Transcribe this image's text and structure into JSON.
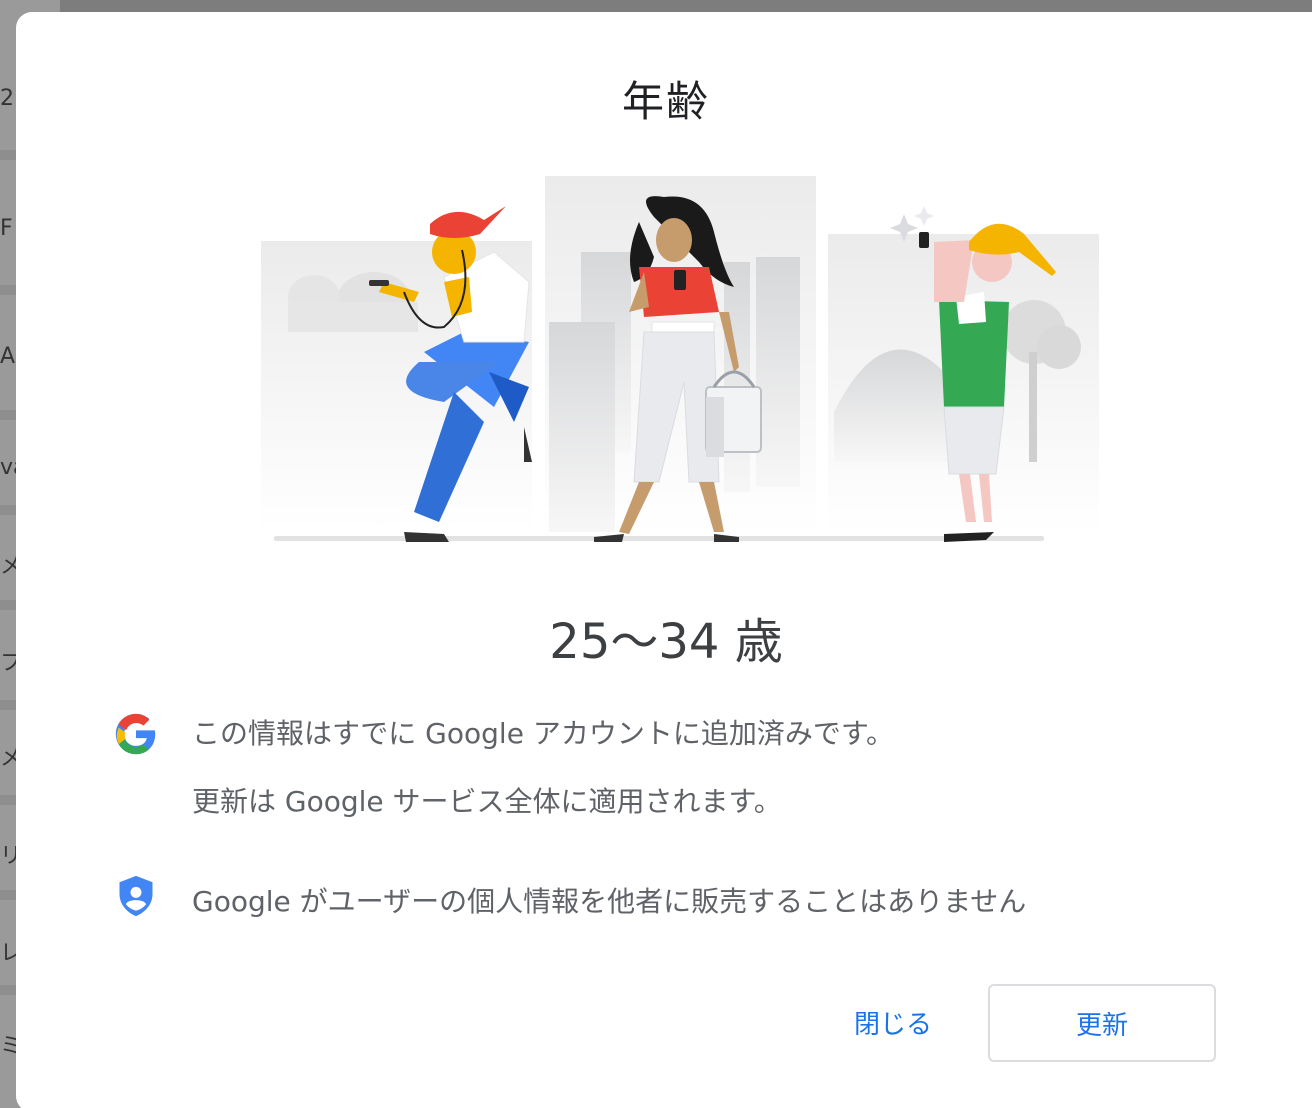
{
  "background_page": {
    "visible_chars": [
      "2",
      "F",
      "A",
      "va",
      "メ",
      "フ",
      "メ",
      "リ",
      "レ",
      "ミ"
    ]
  },
  "dialog": {
    "title": "年齢",
    "age_range": "25〜34 歳",
    "info_google": {
      "icon": "google-g-icon",
      "line1": "この情報はすでに Google アカウントに追加済みです。",
      "line2": "更新は Google サービス全体に適用されます。"
    },
    "info_privacy": {
      "icon": "shield-person-icon",
      "text": "Google がユーザーの個人情報を他者に販売することはありません"
    },
    "buttons": {
      "close": "閉じる",
      "update": "更新"
    }
  },
  "colors": {
    "accent": "#1a73e8",
    "text_primary": "#202124",
    "text_secondary": "#5f6368",
    "google_blue": "#4285f4",
    "google_red": "#ea4335",
    "google_yellow": "#fbbc04",
    "google_green": "#34a853"
  }
}
